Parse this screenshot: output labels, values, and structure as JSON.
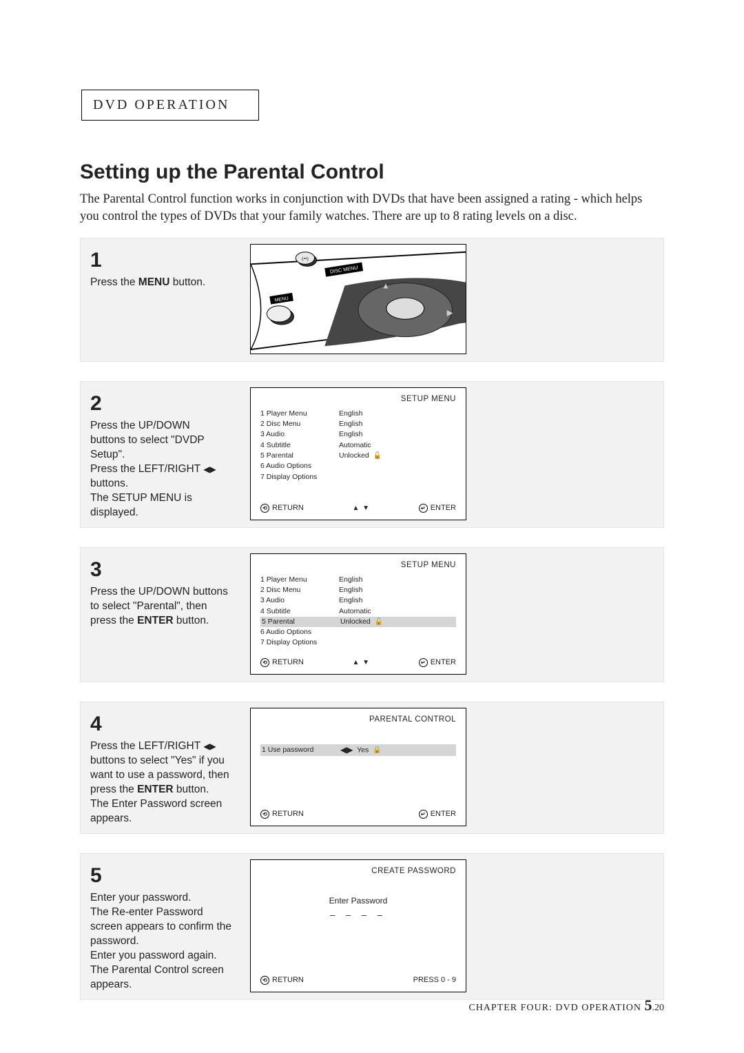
{
  "section_tag": "DVD OPERATION",
  "heading": "Setting up the Parental Control",
  "intro": "The Parental Control function works in conjunction with DVDs that have been assigned a rating - which helps you control the types of DVDs that your family watches. There are up to 8 rating levels on a disc.",
  "steps": {
    "s1": {
      "num": "1",
      "text_a": "Press the ",
      "bold": "MENU",
      "text_b": " button."
    },
    "s2": {
      "num": "2",
      "line1": "Press the UP/DOWN",
      "line2": "buttons to select  \"DVDP Setup\".",
      "line3a": "Press the LEFT/RIGHT ",
      "line3_arrows": "◀▶",
      "line3b": " buttons.",
      "line4": "The SETUP MENU is displayed."
    },
    "s3": {
      "num": "3",
      "line1": "Press the UP/DOWN buttons to select \"Parental\", then press the ",
      "bold": "ENTER",
      "line2": " button."
    },
    "s4": {
      "num": "4",
      "line1a": "Press the LEFT/RIGHT ",
      "arrows": "◀▶",
      "line1b": " buttons to select \"Yes\" if you want to use a password, then press the ",
      "bold": "ENTER",
      "line1c": " button.",
      "line2": "The Enter Password screen appears."
    },
    "s5": {
      "num": "5",
      "line1": "Enter your password.",
      "line2": "The Re-enter Password screen appears to confirm the password.",
      "line3": "Enter you password again.",
      "line4": "The Parental Control screen appears."
    }
  },
  "panel_common": {
    "title_setup": "SETUP  MENU",
    "title_parental": "PARENTAL CONTROL",
    "title_create": "CREATE PASSWORD",
    "return": "RETURN",
    "enter": "ENTER",
    "press09": "PRESS  0 - 9",
    "updown": "▲ ▼",
    "leftright": "◀▶"
  },
  "setup_menu": {
    "rows": [
      {
        "l": "1  Player Menu",
        "r": "English"
      },
      {
        "l": "2  Disc Menu",
        "r": "English"
      },
      {
        "l": "3  Audio",
        "r": "English"
      },
      {
        "l": "4  Subtitle",
        "r": "Automatic"
      },
      {
        "l": "5  Parental",
        "r": "Unlocked"
      },
      {
        "l": "6  Audio Options",
        "r": ""
      },
      {
        "l": "7  Display Options",
        "r": ""
      }
    ],
    "lock_glyph": "🔓"
  },
  "parental_panel": {
    "row_label": "1  Use password",
    "row_value": "Yes",
    "lock": "🔒"
  },
  "create_pw": {
    "label": "Enter Password",
    "dashes": "–  –  –  –"
  },
  "remote_labels": {
    "disc_menu": "DISC MENU",
    "menu": "MENU"
  },
  "footer": {
    "chap": "CHAPTER FOUR: DVD OPERATION ",
    "page": "5",
    "sub": ".20"
  }
}
